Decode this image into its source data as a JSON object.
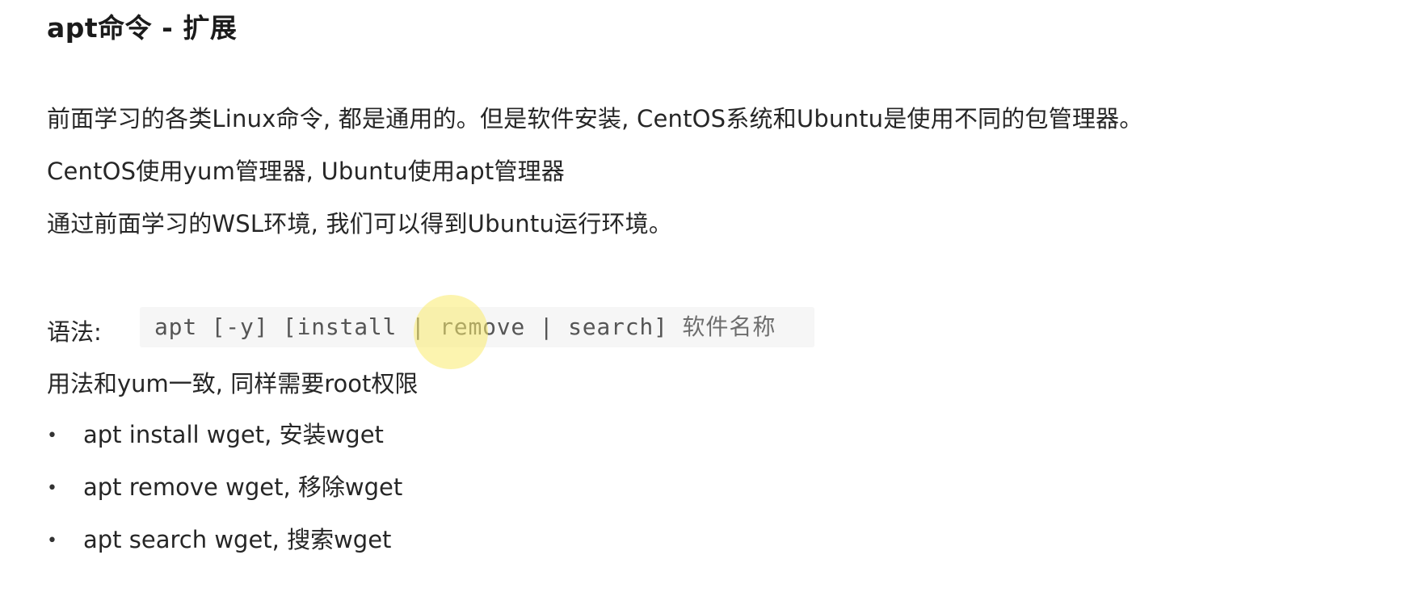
{
  "heading": "apt命令 - 扩展",
  "paragraphs": [
    "前面学习的各类Linux命令, 都是通用的。但是软件安装, CentOS系统和Ubuntu是使用不同的包管理器。",
    "CentOS使用yum管理器, Ubuntu使用apt管理器",
    "通过前面学习的WSL环境, 我们可以得到Ubuntu运行环境。"
  ],
  "syntax": {
    "label": "语法:",
    "code": "apt [-y] [install | remove | search]",
    "code_tail": "软件名称"
  },
  "usage_note": "用法和yum一致, 同样需要root权限",
  "bullets": [
    "apt install wget, 安装wget",
    "apt remove wget, 移除wget",
    "apt search wget, 搜索wget"
  ],
  "bullet_glyph": "•",
  "colors": {
    "text": "#262626",
    "code_background": "#f6f6f6",
    "cursor_highlight": "#faeb6e"
  }
}
